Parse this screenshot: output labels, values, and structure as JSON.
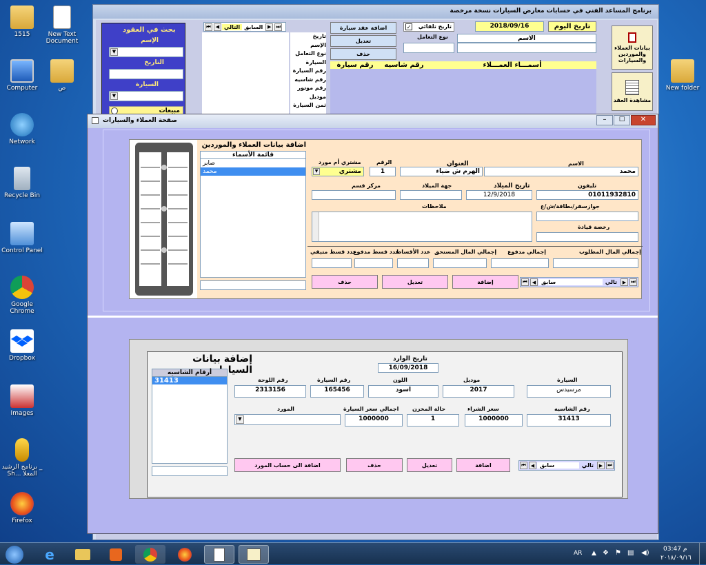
{
  "desktop": {
    "icons": [
      {
        "label": "1515",
        "icon": "folder-icon"
      },
      {
        "label": "New Text Document",
        "icon": "text-file-icon"
      },
      {
        "label": "Computer",
        "icon": "computer-icon"
      },
      {
        "label": "ص",
        "icon": "folder-icon"
      },
      {
        "label": "Network",
        "icon": "network-icon"
      },
      {
        "label": "Recycle Bin",
        "icon": "recycle-bin-icon"
      },
      {
        "label": "Control Panel",
        "icon": "control-panel-icon"
      },
      {
        "label": "Google Chrome",
        "icon": "chrome-icon"
      },
      {
        "label": "Dropbox",
        "icon": "dropbox-icon"
      },
      {
        "label": "Images",
        "icon": "images-icon"
      },
      {
        "label": "برنامج الرشيد _ Sh... المعلا",
        "icon": "key-shortcut-icon"
      },
      {
        "label": "Firefox",
        "icon": "firefox-icon"
      },
      {
        "label": "New folder",
        "icon": "folder-icon"
      }
    ]
  },
  "main_window": {
    "title": "برنامج المساعد الفني في حسابات معارض السيارات نسخة مرخصة",
    "search": {
      "title": "بحث في العقود",
      "name_label": "الإسم",
      "date_label": "التاريخ",
      "car_label": "السيارة",
      "sales_radio": "مبيعات"
    },
    "nav": {
      "next": "التالي",
      "prev": "السابق"
    },
    "contract_labels": [
      "تاريخ",
      "الإسم",
      "نوع التعامل",
      "السيارة",
      "رقم السيارة",
      "رقم شاسيه",
      "رقم موتور",
      "موديل",
      "ثمن السيارة"
    ],
    "buttons": {
      "add_contract": "اضافة عقد سيارة",
      "edit": "تعديل",
      "delete": "حذف"
    },
    "date_checkbox_label": "تاريخ تلقائي",
    "date_value": "2018/09/16",
    "today_label": "تاريخ اليوم",
    "deal_type_label": "نوع التعامل",
    "name_label": "الاسم",
    "col_headers": {
      "car_no": "رقم سيارة",
      "chassis_no": "رقم شاسيه",
      "customers": "أسمـــاء العمـــلاء"
    },
    "right_buttons": {
      "customers_data": "بيانات العملاء والموردين والسيارات",
      "view_contracts": "مشاهدة العقد"
    }
  },
  "dialog": {
    "title": "صفحة العملاء والسيارات",
    "customers": {
      "section_title": "اضافة بيانات العملاء والموردين",
      "list_title": "قائمة الأسماء",
      "names": [
        "صابر",
        "محمد"
      ],
      "selected_index": 1,
      "labels": {
        "name": "الاسم",
        "address": "العنوان",
        "number": "الرقم",
        "buyer_or_supplier": "مشتري أم مورد",
        "phone": "تليفون",
        "birth_date": "تاريخ الميلاد",
        "birth_place": "جهة الميلاد",
        "police_station": "مركز قسم",
        "passport": "جوازسفر/بطاقة/ش/ع",
        "notes": "ملاحظات",
        "license": "رخصة قيادة",
        "total_required": "إجمالي المال المطلوب",
        "total_paid": "إجمالي مدفوع",
        "total_due": "إجمالي المال المستحق",
        "installments": "عدد الأقساط",
        "paid_installments": "عدد قسط مدفوع",
        "remaining_installments": "عدد قسط متبقي"
      },
      "values": {
        "name": "محمد",
        "address": "الهرم ش ضياء",
        "number": "1",
        "buyer_or_supplier": "مشتري",
        "phone": "01011932810",
        "birth_date": "12/9/2018"
      },
      "buttons": {
        "add": "إضافة",
        "edit": "تعديل",
        "delete": "حذف"
      },
      "nav": {
        "next": "تالي",
        "prev": "سابق"
      }
    },
    "cars": {
      "section_title": "إضافة بيانات السيارات",
      "list_title": "أرقام الشاسيه",
      "chassis_list": [
        "31413"
      ],
      "labels": {
        "arrival_date": "تاريخ الوارد",
        "car": "السيارة",
        "model": "موديل",
        "color": "اللون",
        "car_no": "رقم السيارة",
        "plate_no": "رقم اللوحة",
        "chassis": "رقم الشاسيه",
        "buy_price": "سعر الشراء",
        "stock_status": "حالة المخزن",
        "total_price": "اجمالي سعر السيارة",
        "supplier": "المورد"
      },
      "values": {
        "arrival_date": "16/09/2018",
        "car": "مرسيدس",
        "model": "2017",
        "color": "اسود",
        "car_no": "165456",
        "plate_no": "2313156",
        "chassis": "31413",
        "buy_price": "1000000",
        "stock_status": "1",
        "total_price": "1000000"
      },
      "buttons": {
        "add": "اضافة",
        "edit": "تعديل",
        "delete": "حذف",
        "add_to_supplier": "اضافة الى حساب المورد"
      },
      "nav": {
        "next": "تالي",
        "prev": "سابق"
      }
    }
  },
  "taskbar": {
    "language": "AR",
    "time": "03:47 م",
    "date": "٢٠١٨/٠٩/١٦"
  }
}
